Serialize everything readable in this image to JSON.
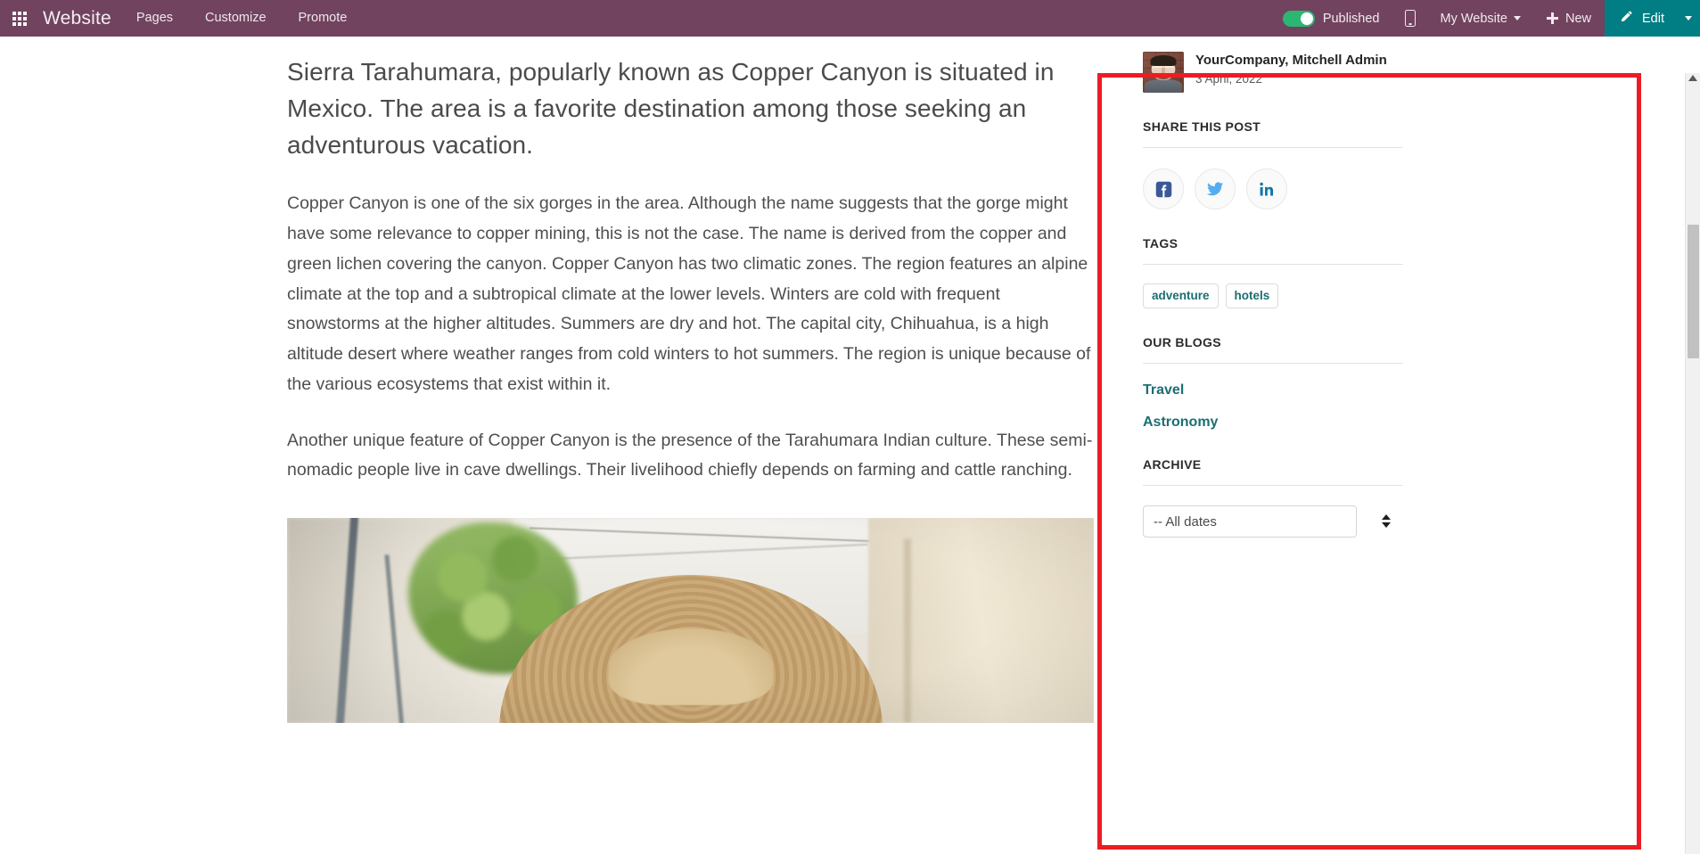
{
  "navbar": {
    "apps_icon": "apps-grid-icon",
    "brand": "Website",
    "menu_items": [
      {
        "label": "Pages"
      },
      {
        "label": "Customize"
      },
      {
        "label": "Promote"
      }
    ],
    "publish_toggle": {
      "label": "Published",
      "state": "on",
      "on_color": "#2bb673"
    },
    "mobile_preview_icon": "mobile-phone-icon",
    "website_selector": "My Website",
    "new_button": "New",
    "edit_button": "Edit",
    "colors": {
      "navbar_bg": "#71435f",
      "edit_bg": "#017e84"
    }
  },
  "article": {
    "lead": "Sierra Tarahumara, popularly known as Copper Canyon is situated in Mexico. The area is a favorite destination among those seeking an adventurous vacation.",
    "paragraphs": [
      "Copper Canyon is one of the six gorges in the area. Although the name suggests that the gorge might have some relevance to copper mining, this is not the case. The name is derived from the copper and green lichen covering the canyon. Copper Canyon has two climatic zones. The region features an alpine climate at the top and a subtropical climate at the lower levels. Winters are cold with frequent snowstorms at the higher altitudes. Summers are dry and hot. The capital city, Chihuahua, is a high altitude desert where weather ranges from cold winters to hot summers. The region is unique because of the various ecosystems that exist within it.",
      "Another unique feature of Copper Canyon is the presence of the Tarahumara Indian culture. These semi-nomadic people live in cave dwellings. Their livelihood chiefly depends on farming and cattle ranching."
    ],
    "photo_alt": "Man wearing a straw sombrero in a sunlit alley"
  },
  "sidebar": {
    "author": {
      "name": "YourCompany, Mitchell Admin",
      "date": "3 April, 2022",
      "avatar": "author-avatar-photo"
    },
    "share": {
      "title": "SHARE THIS POST",
      "networks": [
        {
          "name": "facebook-icon",
          "color": "#3b5998"
        },
        {
          "name": "twitter-icon",
          "color": "#55acee"
        },
        {
          "name": "linkedin-icon",
          "color": "#0e76a8"
        }
      ]
    },
    "tags": {
      "title": "TAGS",
      "items": [
        {
          "label": "adventure"
        },
        {
          "label": "hotels"
        }
      ]
    },
    "blogs": {
      "title": "OUR BLOGS",
      "items": [
        {
          "label": "Travel"
        },
        {
          "label": "Astronomy"
        }
      ]
    },
    "archive": {
      "title": "ARCHIVE",
      "selected": "-- All dates",
      "options": [
        "-- All dates"
      ]
    },
    "accent_color": "#1b6e72"
  },
  "overlay": {
    "highlight_color": "#ed1c24"
  }
}
